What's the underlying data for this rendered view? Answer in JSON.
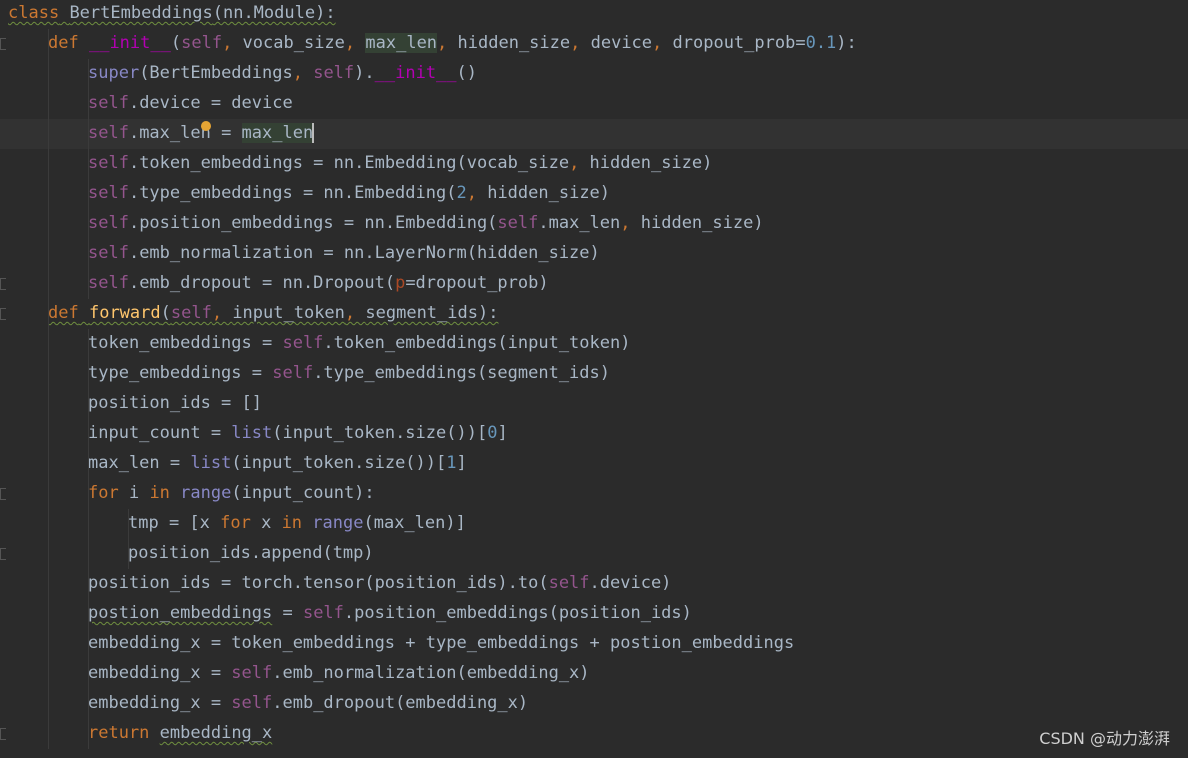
{
  "editor": {
    "lines": [
      {
        "indent": 0,
        "tokens": [
          {
            "t": "class",
            "c": "kw wavy"
          },
          {
            "t": " ",
            "c": "wavy"
          },
          {
            "t": "BertEmbeddings",
            "c": "wavy"
          },
          {
            "t": "(nn.Module):",
            "c": "wavy"
          }
        ]
      },
      {
        "indent": 1,
        "tokens": [
          {
            "t": "def",
            "c": "kw"
          },
          {
            "t": " "
          },
          {
            "t": "__init__",
            "c": "dunder"
          },
          {
            "t": "("
          },
          {
            "t": "self",
            "c": "self"
          },
          {
            "t": ", ",
            "c": "kw"
          },
          {
            "t": "vocab_size"
          },
          {
            "t": ", ",
            "c": "kw"
          },
          {
            "t": "max_len",
            "c": "hl"
          },
          {
            "t": ", ",
            "c": "kw"
          },
          {
            "t": "hidden_size"
          },
          {
            "t": ", ",
            "c": "kw"
          },
          {
            "t": "device"
          },
          {
            "t": ", ",
            "c": "kw"
          },
          {
            "t": "dropout_prob="
          },
          {
            "t": "0.1",
            "c": "num"
          },
          {
            "t": "):"
          }
        ]
      },
      {
        "indent": 2,
        "tokens": [
          {
            "t": "super",
            "c": "builtin"
          },
          {
            "t": "(BertEmbeddings"
          },
          {
            "t": ", ",
            "c": "kw"
          },
          {
            "t": "self",
            "c": "self"
          },
          {
            "t": ")."
          },
          {
            "t": "__init__",
            "c": "dunder"
          },
          {
            "t": "()"
          }
        ]
      },
      {
        "indent": 2,
        "tokens": [
          {
            "t": "self",
            "c": "self"
          },
          {
            "t": ".device = device"
          }
        ]
      },
      {
        "indent": 2,
        "current": true,
        "tokens": [
          {
            "t": "self",
            "c": "self"
          },
          {
            "t": ".max_len = "
          },
          {
            "t": "max_len",
            "c": "hl"
          }
        ]
      },
      {
        "indent": 2,
        "tokens": [
          {
            "t": "self",
            "c": "self"
          },
          {
            "t": ".token_embeddings = nn.Embedding(vocab_size"
          },
          {
            "t": ", ",
            "c": "kw"
          },
          {
            "t": "hidden_size)"
          }
        ]
      },
      {
        "indent": 2,
        "tokens": [
          {
            "t": "self",
            "c": "self"
          },
          {
            "t": ".type_embeddings = nn.Embedding("
          },
          {
            "t": "2",
            "c": "num"
          },
          {
            "t": ", ",
            "c": "kw"
          },
          {
            "t": "hidden_size)"
          }
        ]
      },
      {
        "indent": 2,
        "tokens": [
          {
            "t": "self",
            "c": "self"
          },
          {
            "t": ".position_embeddings = nn.Embedding("
          },
          {
            "t": "self",
            "c": "self"
          },
          {
            "t": ".max_len"
          },
          {
            "t": ", ",
            "c": "kw"
          },
          {
            "t": "hidden_size)"
          }
        ]
      },
      {
        "indent": 2,
        "tokens": [
          {
            "t": "self",
            "c": "self"
          },
          {
            "t": ".emb_normalization = nn.LayerNorm(hidden_size)"
          }
        ]
      },
      {
        "indent": 2,
        "tokens": [
          {
            "t": "self",
            "c": "self"
          },
          {
            "t": ".emb_dropout = nn.Dropout("
          },
          {
            "t": "p",
            "c": "param"
          },
          {
            "t": "=dropout_prob)"
          }
        ]
      },
      {
        "indent": 1,
        "tokens": [
          {
            "t": "def",
            "c": "kw wavy"
          },
          {
            "t": " ",
            "c": "wavy"
          },
          {
            "t": "forward",
            "c": "fn wavy"
          },
          {
            "t": "(",
            "c": "wavy"
          },
          {
            "t": "self",
            "c": "self wavy"
          },
          {
            "t": ", ",
            "c": "kw wavy"
          },
          {
            "t": "input_token",
            "c": "wavy"
          },
          {
            "t": ", ",
            "c": "kw wavy"
          },
          {
            "t": "segment_ids):",
            "c": "wavy"
          }
        ]
      },
      {
        "indent": 2,
        "tokens": [
          {
            "t": "token_embeddings = "
          },
          {
            "t": "self",
            "c": "self"
          },
          {
            "t": ".token_embeddings(input_token)"
          }
        ]
      },
      {
        "indent": 2,
        "tokens": [
          {
            "t": "type_embeddings = "
          },
          {
            "t": "self",
            "c": "self"
          },
          {
            "t": ".type_embeddings(segment_ids)"
          }
        ]
      },
      {
        "indent": 2,
        "tokens": [
          {
            "t": "position_ids = []"
          }
        ]
      },
      {
        "indent": 2,
        "tokens": [
          {
            "t": "input_count = "
          },
          {
            "t": "list",
            "c": "builtin"
          },
          {
            "t": "(input_token.size())["
          },
          {
            "t": "0",
            "c": "num"
          },
          {
            "t": "]"
          }
        ]
      },
      {
        "indent": 2,
        "tokens": [
          {
            "t": "max_len = "
          },
          {
            "t": "list",
            "c": "builtin"
          },
          {
            "t": "(input_token.size())["
          },
          {
            "t": "1",
            "c": "num"
          },
          {
            "t": "]"
          }
        ]
      },
      {
        "indent": 2,
        "tokens": [
          {
            "t": "for",
            "c": "kw"
          },
          {
            "t": " i "
          },
          {
            "t": "in",
            "c": "kw"
          },
          {
            "t": " "
          },
          {
            "t": "range",
            "c": "builtin"
          },
          {
            "t": "(input_count):"
          }
        ]
      },
      {
        "indent": 3,
        "tokens": [
          {
            "t": "tmp = [x "
          },
          {
            "t": "for",
            "c": "kw"
          },
          {
            "t": " x "
          },
          {
            "t": "in",
            "c": "kw"
          },
          {
            "t": " "
          },
          {
            "t": "range",
            "c": "builtin"
          },
          {
            "t": "(max_len)]"
          }
        ]
      },
      {
        "indent": 3,
        "tokens": [
          {
            "t": "position_ids.append(tmp)"
          }
        ]
      },
      {
        "indent": 2,
        "tokens": [
          {
            "t": "position_ids = torch.tensor(position_ids).to("
          },
          {
            "t": "self",
            "c": "self"
          },
          {
            "t": ".device)"
          }
        ]
      },
      {
        "indent": 2,
        "tokens": [
          {
            "t": "postion_embeddings",
            "c": "wavy"
          },
          {
            "t": " = "
          },
          {
            "t": "self",
            "c": "self"
          },
          {
            "t": ".position_embeddings(position_ids)"
          }
        ]
      },
      {
        "indent": 2,
        "tokens": [
          {
            "t": "embedding_x = token_embeddings + type_embeddings + postion_embeddings"
          }
        ]
      },
      {
        "indent": 2,
        "tokens": [
          {
            "t": "embedding_x = "
          },
          {
            "t": "self",
            "c": "self"
          },
          {
            "t": ".emb_normalization(embedding_x)"
          }
        ]
      },
      {
        "indent": 2,
        "tokens": [
          {
            "t": "embedding_x = "
          },
          {
            "t": "self",
            "c": "self"
          },
          {
            "t": ".emb_dropout(embedding_x)"
          }
        ]
      },
      {
        "indent": 2,
        "tokens": [
          {
            "t": "return",
            "c": "kw"
          },
          {
            "t": " "
          },
          {
            "t": "embedding_x",
            "c": "wavy"
          }
        ]
      }
    ]
  },
  "watermark": "CSDN @动力澎湃",
  "colors": {
    "background": "#2b2b2b",
    "text": "#a9b7c6",
    "keyword": "#cc7832",
    "self": "#94558d",
    "number": "#6897bb",
    "dunder": "#b200b2",
    "builtin": "#8888c6",
    "function": "#ffc66d",
    "param": "#aa4926"
  }
}
